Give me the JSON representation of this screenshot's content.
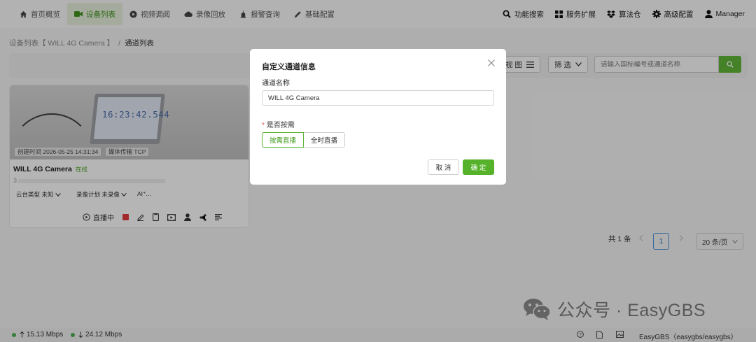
{
  "nav": {
    "items": [
      {
        "label": "首页概览",
        "icon": "home-icon"
      },
      {
        "label": "设备列表",
        "icon": "video-camera-icon",
        "active": true
      },
      {
        "label": "视频调阅",
        "icon": "play-circle-icon"
      },
      {
        "label": "录像回放",
        "icon": "cloud-icon"
      },
      {
        "label": "报警查询",
        "icon": "alarm-icon"
      },
      {
        "label": "基础配置",
        "icon": "pencil-icon"
      }
    ],
    "right": [
      {
        "label": "功能搜索",
        "icon": "search-icon"
      },
      {
        "label": "服务扩展",
        "icon": "grid-icon"
      },
      {
        "label": "算法仓",
        "icon": "dropbox-icon"
      },
      {
        "label": "高级配置",
        "icon": "gear-icon"
      },
      {
        "label": "Manager",
        "icon": "user-icon"
      }
    ]
  },
  "breadcrumb": {
    "parent": "设备列表【 WILL 4G Camera 】",
    "current": "通道列表"
  },
  "toolbar": {
    "view_label": "视 图",
    "filter_label": "筛 选",
    "search_placeholder": "请输入国标编号或通道名称"
  },
  "card": {
    "created": "创建时间 2026-05-25 14:31:34",
    "transport": "媒体传输 TCP",
    "clock_text": "16:23:42.544",
    "name": "WILL 4G Camera",
    "status": "在线",
    "id_prefix": "3",
    "ptz": "云台类型 未知",
    "record": "录像计划 未录像",
    "ai": "AI⁺...",
    "live_label": "直播中"
  },
  "pagination": {
    "total": "共 1 条",
    "page": "1",
    "page_size": "20 条/页"
  },
  "modal": {
    "title": "自定义通道信息",
    "name_label": "通道名称",
    "name_value": "WILL 4G Camera",
    "ondemand_label": "是否按需",
    "opt_on": "按需直播",
    "opt_off": "全时直播",
    "cancel": "取 消",
    "ok": "确 定"
  },
  "statusbar": {
    "up": "15.13 Mbps",
    "down": "24.12 Mbps",
    "brand": "EasyGBS（easygbs/easygbs）"
  },
  "watermark": "公众号 · EasyGBS",
  "colors": {
    "accent": "#55b22a",
    "online": "#4aa324",
    "record_red": "#e03c3c"
  }
}
